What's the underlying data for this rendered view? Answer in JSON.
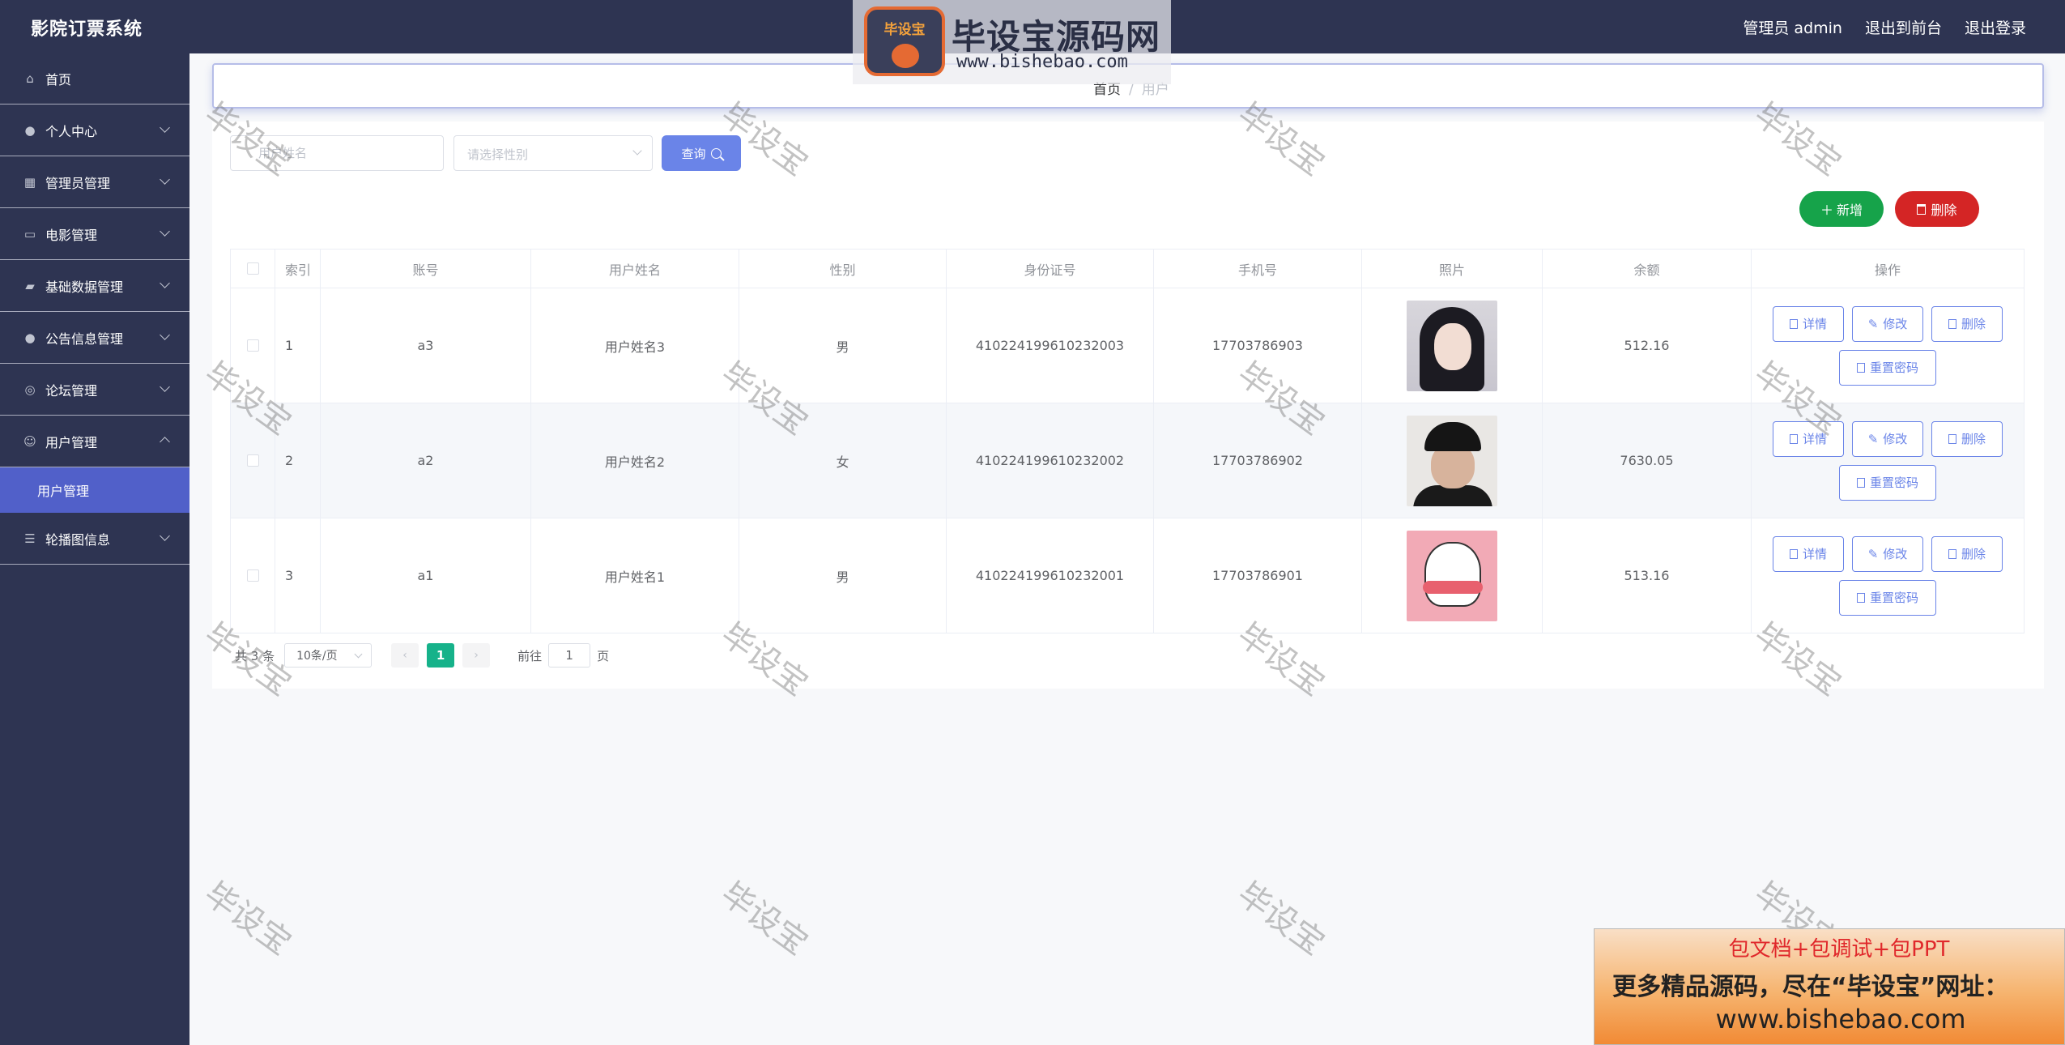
{
  "app": {
    "title": "影院订票系统"
  },
  "header": {
    "links": [
      "管理员 admin",
      "退出到前台",
      "退出登录"
    ]
  },
  "watermark_logo": {
    "badge": "毕设宝",
    "name": "毕设宝源码网",
    "url": "www.bishebao.com"
  },
  "watermark_text": "毕设宝",
  "sidebar": {
    "items": [
      {
        "label": "首页",
        "icon": "home-icon"
      },
      {
        "label": "个人中心",
        "icon": "user-icon"
      },
      {
        "label": "管理员管理",
        "icon": "grid-icon"
      },
      {
        "label": "电影管理",
        "icon": "monitor-icon"
      },
      {
        "label": "基础数据管理",
        "icon": "gavel-icon"
      },
      {
        "label": "公告信息管理",
        "icon": "user-icon"
      },
      {
        "label": "论坛管理",
        "icon": "compass-icon"
      },
      {
        "label": "用户管理",
        "icon": "smile-icon"
      },
      {
        "label": "轮播图信息",
        "icon": "list-icon"
      }
    ],
    "active_sub": "用户管理"
  },
  "breadcrumb": {
    "home": "首页",
    "current": "用户"
  },
  "search": {
    "name_placeholder": "用户姓名",
    "gender_placeholder": "请选择性别",
    "query_label": "查询"
  },
  "actions": {
    "add_label": "新增",
    "delete_label": "删除"
  },
  "table": {
    "headers": [
      "索引",
      "账号",
      "用户姓名",
      "性别",
      "身份证号",
      "手机号",
      "照片",
      "余额",
      "操作"
    ],
    "rows": [
      {
        "index": "1",
        "account": "a3",
        "name": "用户姓名3",
        "gender": "男",
        "id_card": "410224199610232003",
        "phone": "17703786903",
        "balance": "512.16"
      },
      {
        "index": "2",
        "account": "a2",
        "name": "用户姓名2",
        "gender": "女",
        "id_card": "410224199610232002",
        "phone": "17703786902",
        "balance": "7630.05"
      },
      {
        "index": "3",
        "account": "a1",
        "name": "用户姓名1",
        "gender": "男",
        "id_card": "410224199610232001",
        "phone": "17703786901",
        "balance": "513.16"
      }
    ],
    "row_actions": {
      "detail": "详情",
      "edit": "修改",
      "delete": "删除",
      "reset": "重置密码"
    }
  },
  "pagination": {
    "total": "共 3 条",
    "page_size": "10条/页",
    "current": "1",
    "goto_prefix": "前往",
    "goto_value": "1",
    "goto_suffix": "页"
  },
  "ad": {
    "line1": "包文档+包调试+包PPT",
    "line2": "更多精品源码，尽在“毕设宝”网址：",
    "line3": "www.bishebao.com"
  }
}
